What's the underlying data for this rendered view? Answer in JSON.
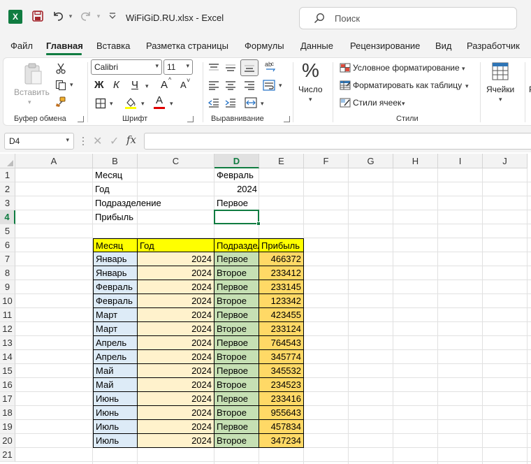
{
  "titlebar": {
    "app_badge": "X",
    "document_title": "WiFiGiD.RU.xlsx  -  Excel",
    "search_placeholder": "Поиск"
  },
  "menu": {
    "tabs": [
      "Файл",
      "Главная",
      "Вставка",
      "Разметка страницы",
      "Формулы",
      "Данные",
      "Рецензирование",
      "Вид",
      "Разработчик"
    ],
    "active_tab": "Главная"
  },
  "ribbon": {
    "clipboard": {
      "paste_label": "Вставить",
      "group_label": "Буфер обмена"
    },
    "font": {
      "font_name": "Calibri",
      "font_size": "11",
      "bold": "Ж",
      "italic": "К",
      "underline": "Ч",
      "grow": "A",
      "shrink": "A",
      "font_color_letter": "A",
      "group_label": "Шрифт",
      "fill_color": "#ffff00",
      "font_color": "#e00000"
    },
    "alignment": {
      "group_label": "Выравнивание"
    },
    "number": {
      "format_symbol": "%",
      "label": "Число"
    },
    "styles": {
      "conditional_formatting": "Условное форматирование",
      "format_as_table": "Форматировать как таблицу",
      "cell_styles": "Стили ячеек",
      "group_label": "Стили"
    },
    "cells": {
      "label": "Ячейки"
    }
  },
  "formula_bar": {
    "name_box": "D4",
    "fx": "fx",
    "cancel_symbol": "✕",
    "enter_symbol": "✓",
    "formula": ""
  },
  "sheet": {
    "columns": [
      "A",
      "B",
      "C",
      "D",
      "E",
      "F",
      "G",
      "H",
      "I",
      "J"
    ],
    "selected_column": "D",
    "rows": [
      "1",
      "2",
      "3",
      "4",
      "5",
      "6",
      "7",
      "8",
      "9",
      "10",
      "11",
      "12",
      "13",
      "14",
      "15",
      "16",
      "17",
      "18",
      "19",
      "20",
      "21"
    ],
    "selected_row": "4",
    "active_cell": "D4",
    "params": [
      {
        "label": "Месяц",
        "value": "Февраль",
        "align": "left"
      },
      {
        "label": "Год",
        "value": "2024",
        "align": "right"
      },
      {
        "label": "Подразделение",
        "value": "Первое",
        "align": "left"
      },
      {
        "label": "Прибыль",
        "value": "",
        "align": "left"
      }
    ],
    "table": {
      "headers": [
        "Месяц",
        "Год",
        "Подразделение",
        "Прибыль"
      ],
      "header_color": "#ffff00",
      "column_colors": [
        "#ddebf7",
        "#fff2cc",
        "#c6e0b4",
        "#ffd966"
      ],
      "rows": [
        [
          "Январь",
          "2024",
          "Первое",
          "466372"
        ],
        [
          "Январь",
          "2024",
          "Второе",
          "233412"
        ],
        [
          "Февраль",
          "2024",
          "Первое",
          "233145"
        ],
        [
          "Февраль",
          "2024",
          "Второе",
          "123342"
        ],
        [
          "Март",
          "2024",
          "Первое",
          "423455"
        ],
        [
          "Март",
          "2024",
          "Второе",
          "233124"
        ],
        [
          "Апрель",
          "2024",
          "Первое",
          "764543"
        ],
        [
          "Апрель",
          "2024",
          "Второе",
          "345774"
        ],
        [
          "Май",
          "2024",
          "Первое",
          "345532"
        ],
        [
          "Май",
          "2024",
          "Второе",
          "234523"
        ],
        [
          "Июнь",
          "2024",
          "Первое",
          "233416"
        ],
        [
          "Июнь",
          "2024",
          "Второе",
          "955643"
        ],
        [
          "Июль",
          "2024",
          "Первое",
          "457834"
        ],
        [
          "Июль",
          "2024",
          "Второе",
          "347234"
        ]
      ]
    }
  }
}
